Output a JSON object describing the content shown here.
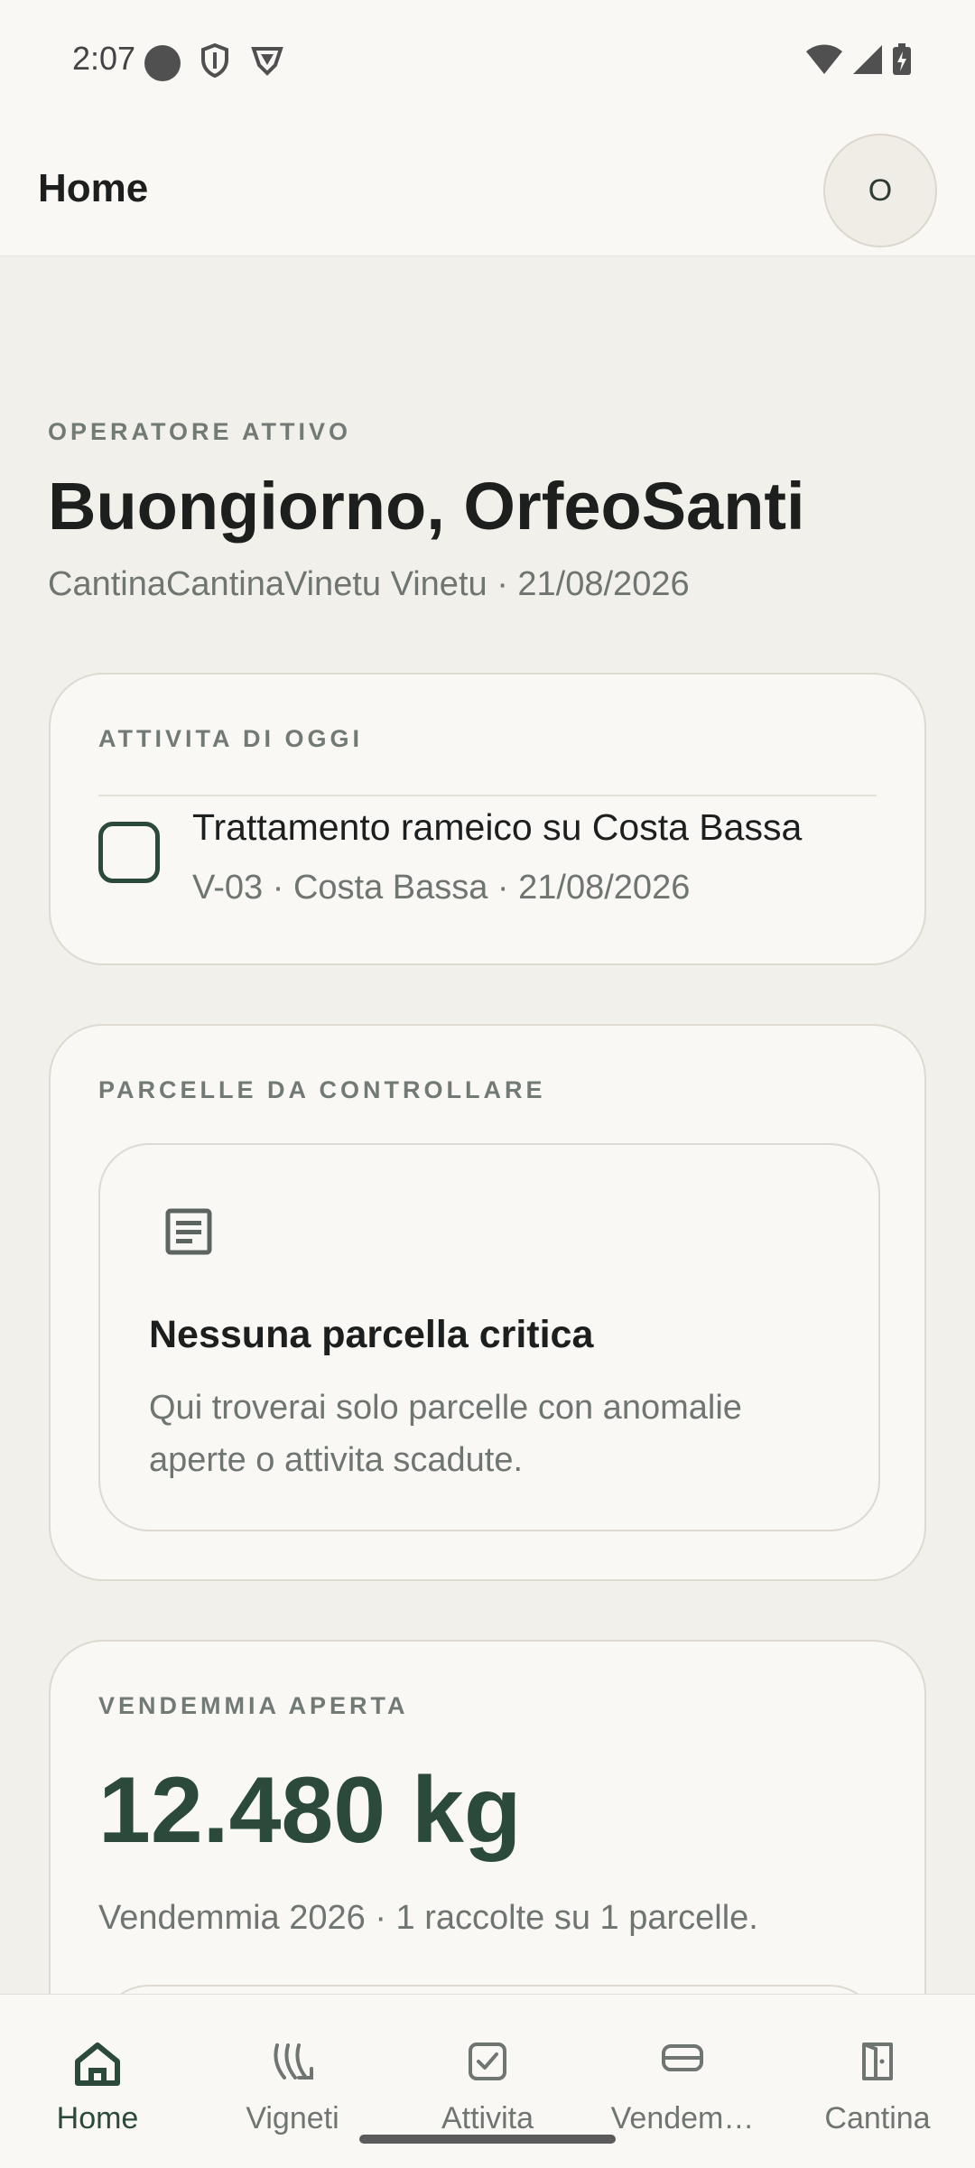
{
  "status": {
    "time": "2:07"
  },
  "appbar": {
    "title": "Home",
    "avatar_initial": "O"
  },
  "hero": {
    "eyebrow": "OPERATORE ATTIVO",
    "greeting": "Buongiorno, OrfeoSanti",
    "subline": "CantinaCantinaVinetu Vinetu · 21/08/2026"
  },
  "tasks_card": {
    "eyebrow": "ATTIVITA DI OGGI",
    "items": [
      {
        "title": "Trattamento rameico su Costa Bassa",
        "meta": "V-03 · Costa Bassa · 21/08/2026",
        "checked": false
      }
    ]
  },
  "parcels_card": {
    "eyebrow": "PARCELLE DA CONTROLLARE",
    "empty_icon": "document-icon",
    "empty_title": "Nessuna parcella critica",
    "empty_text": "Qui troverai solo parcelle con anomalie aperte o attivita scadute."
  },
  "harvest_card": {
    "eyebrow": "VENDEMMIA APERTA",
    "value": "12.480 kg",
    "subtitle": "Vendemmia 2026 · 1 raccolte su 1 parcelle."
  },
  "bottom_nav": {
    "items": [
      {
        "label": "Home",
        "icon": "home-icon",
        "active": true
      },
      {
        "label": "Vigneti",
        "icon": "vineyard-icon",
        "active": false
      },
      {
        "label": "Attivita",
        "icon": "task-check-icon",
        "active": false
      },
      {
        "label": "Vendem…",
        "icon": "harvest-crate-icon",
        "active": false
      },
      {
        "label": "Cantina",
        "icon": "cellar-door-icon",
        "active": false
      }
    ]
  },
  "colors": {
    "accent": "#2b4a3c",
    "background": "#f2f0eb",
    "surface": "#f9f8f5"
  }
}
